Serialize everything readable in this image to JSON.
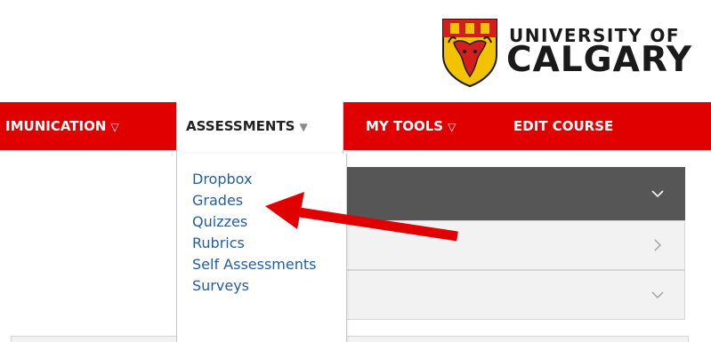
{
  "header": {
    "brand_line1": "UNIVERSITY OF",
    "brand_line2": "CALGARY"
  },
  "nav": {
    "items": [
      {
        "label": "IMUNICATION",
        "caret": "▽"
      },
      {
        "label": "ASSESSMENTS",
        "caret": "▼"
      },
      {
        "label": "MY TOOLS",
        "caret": "▽"
      },
      {
        "label": "EDIT COURSE",
        "caret": ""
      }
    ]
  },
  "dropdown": {
    "items": [
      {
        "label": "Dropbox"
      },
      {
        "label": "Grades"
      },
      {
        "label": "Quizzes"
      },
      {
        "label": "Rubrics"
      },
      {
        "label": "Self Assessments"
      },
      {
        "label": "Surveys"
      }
    ]
  },
  "icons": {
    "crest": "university-crest-icon",
    "panel_expanded": "chevron-down-icon",
    "panel_collapsed": "chevron-right-icon",
    "annotation": "red-arrow-icon"
  },
  "colors": {
    "nav_bar": "#e10000",
    "link": "#1f5ea8",
    "annotation_arrow": "#e10000",
    "dark_panel": "#565656",
    "light_panel": "#f2f2f2"
  }
}
